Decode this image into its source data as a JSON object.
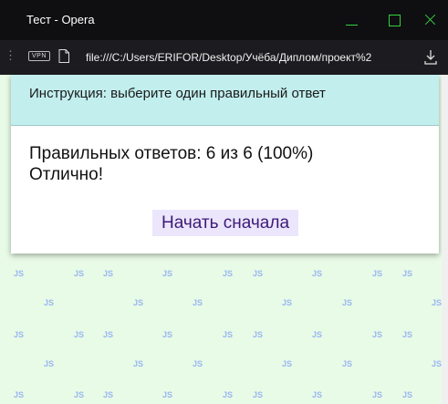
{
  "window": {
    "title": "Тест - Opera"
  },
  "address_bar": {
    "vpn_label": "VPN",
    "url": "file:///C:/Users/ERIFOR/Desktop/Учёба/Диплом/проект%2"
  },
  "quiz": {
    "instruction": "Инструкция: выберите один правильный ответ",
    "score_text": "Правильных ответов: 6 из 6 (100%)",
    "verdict": "Отлично!",
    "restart_label": "Начать сначала"
  },
  "background": {
    "pattern_text": "JS"
  },
  "colors": {
    "accent_green": "#34d13d",
    "instruction_bg": "#c2eeee",
    "button_bg": "#ebe6fb",
    "button_text": "#3d1a78",
    "pattern": "#9ab6f2",
    "page_bg": "#e8fbe6"
  }
}
